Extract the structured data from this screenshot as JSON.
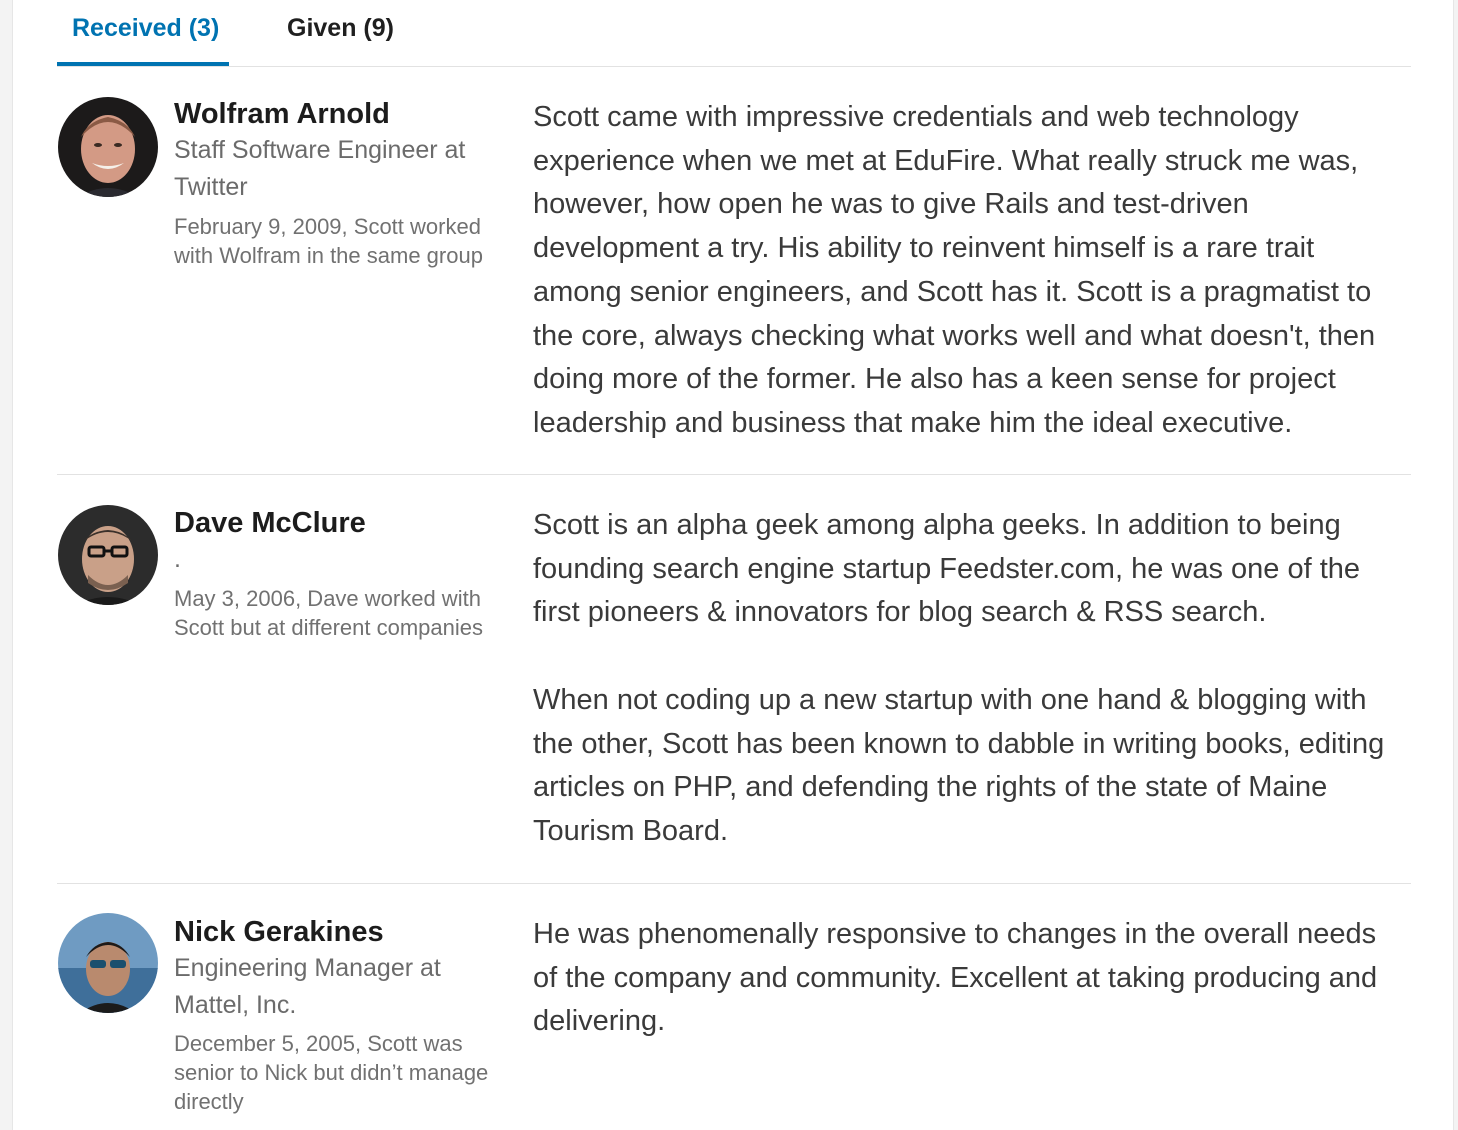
{
  "tabs": [
    {
      "label": "Received (3)"
    },
    {
      "label": "Given (9)"
    }
  ],
  "recommendations": [
    {
      "name": "Wolfram Arnold",
      "headline": "Staff Software Engineer at Twitter",
      "meta": "February 9, 2009, Scott worked with Wolfram in the same group",
      "paragraphs": [
        "Scott came with impressive credentials and web technology experience when we met at EduFire. What really struck me was, however, how open he was to give Rails and test-driven development a try. His ability to reinvent himself is a rare trait among senior engineers, and Scott has it. Scott is a pragmatist to the core, always checking what works well and what doesn't, then doing more of the former. He also has a keen sense for project leadership and business that make him the ideal executive."
      ]
    },
    {
      "name": "Dave McClure",
      "headline": ".",
      "meta": "May 3, 2006, Dave worked with Scott but at different companies",
      "paragraphs": [
        "Scott is an alpha geek among alpha geeks. In addition to being founding search engine startup Feedster.com, he was one of the first pioneers & innovators for blog search & RSS search.",
        "When not coding up a new startup with one hand & blogging with the other, Scott has been known to dabble in writing books, editing articles on PHP, and defending the rights of the state of Maine Tourism Board."
      ]
    },
    {
      "name": "Nick Gerakines",
      "headline": "Engineering Manager at Mattel, Inc.",
      "meta": "December 5, 2005, Scott was senior to Nick but didn’t manage directly",
      "paragraphs": [
        "He was phenomenally responsive to changes in the overall needs of the company and community. Excellent at taking producing and delivering."
      ]
    }
  ],
  "colors": {
    "accent": "#0073b1",
    "name_text": "#1c1c1c",
    "secondary_text": "#6b6b6b",
    "body_text": "#3a3a3a",
    "divider": "#e2e2e2"
  }
}
